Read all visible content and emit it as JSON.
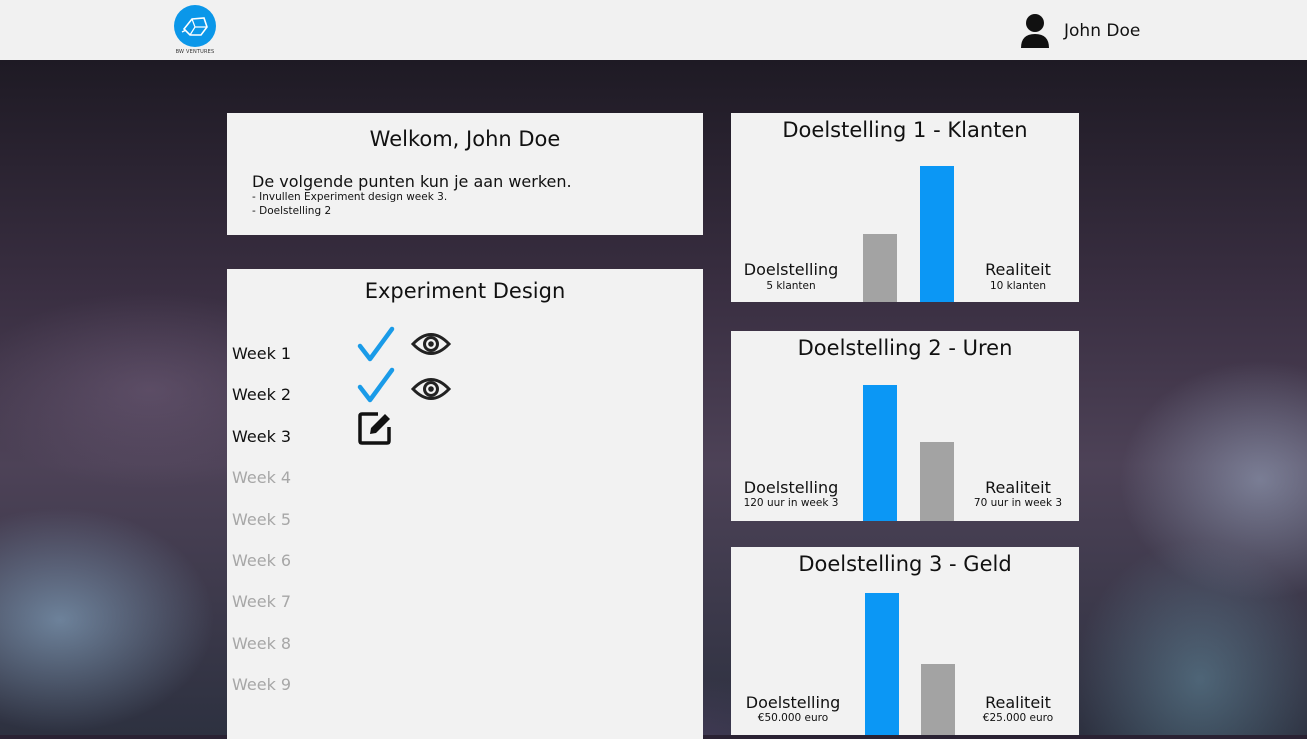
{
  "header": {
    "logo_text": "BW VENTURES",
    "user_name": "John Doe"
  },
  "welcome": {
    "title": "Welkom, John Doe",
    "intro": "De volgende punten kun je aan werken.",
    "todos": [
      "- Invullen Experiment design week 3.",
      "- Doelstelling 2"
    ]
  },
  "experiment": {
    "title": "Experiment Design",
    "weeks": [
      {
        "label": "Week 1",
        "status": "done"
      },
      {
        "label": "Week 2",
        "status": "done"
      },
      {
        "label": "Week 3",
        "status": "edit"
      },
      {
        "label": "Week 4",
        "status": "locked"
      },
      {
        "label": "Week 5",
        "status": "locked"
      },
      {
        "label": "Week 6",
        "status": "locked"
      },
      {
        "label": "Week 7",
        "status": "locked"
      },
      {
        "label": "Week 8",
        "status": "locked"
      },
      {
        "label": "Week 9",
        "status": "locked"
      }
    ]
  },
  "goals": [
    {
      "title": "Doelstelling 1 - Klanten",
      "target_label": "Doelstelling",
      "target_sub": "5 klanten",
      "target_value": 5,
      "actual_label": "Realiteit",
      "actual_sub": "10 klanten",
      "actual_value": 10
    },
    {
      "title": "Doelstelling 2 - Uren",
      "target_label": "Doelstelling",
      "target_sub": "120 uur in week 3",
      "target_value": 120,
      "actual_label": "Realiteit",
      "actual_sub": "70 uur in week 3",
      "actual_value": 70
    },
    {
      "title": "Doelstelling 3 - Geld",
      "target_label": "Doelstelling",
      "target_sub": "€50.000 euro",
      "target_value": 50000,
      "actual_label": "Realiteit",
      "actual_sub": "€25.000 euro",
      "actual_value": 25000
    }
  ],
  "colors": {
    "accent": "#0b97f5",
    "gray_bar": "#a3a3a3",
    "check": "#1a9be8"
  }
}
